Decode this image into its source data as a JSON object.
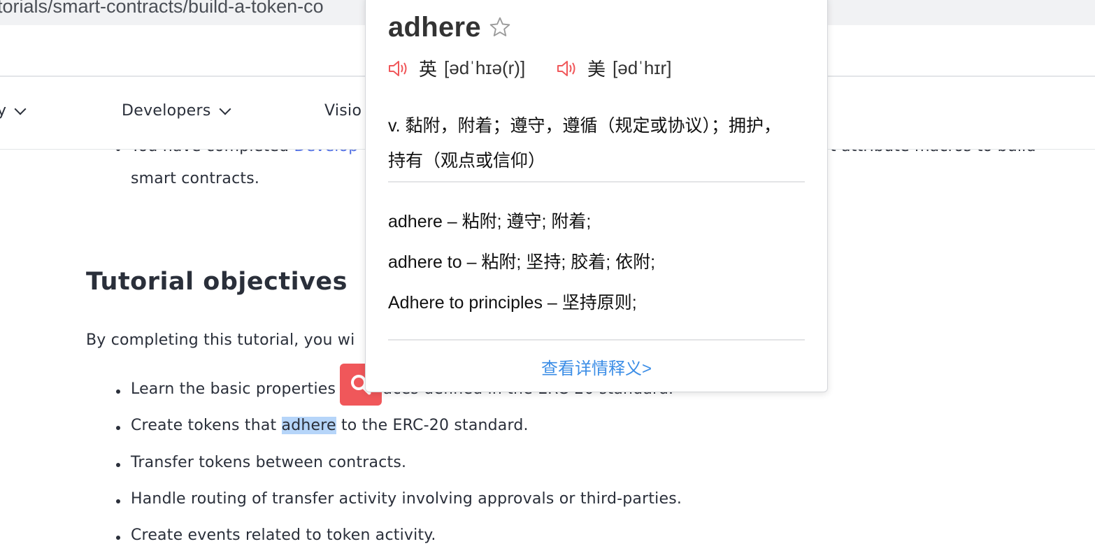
{
  "browser": {
    "url": "torials/smart-contracts/build-a-token-co"
  },
  "nav": {
    "items": [
      {
        "label": "y"
      },
      {
        "label": "Developers"
      },
      {
        "label": "Visio"
      }
    ]
  },
  "content": {
    "bullet_top": {
      "prefix": "You have completed ",
      "link": "Develop",
      "suffix": "t attribute macros to build"
    },
    "bullet_top_line2": "smart contracts.",
    "heading": "Tutorial objectives",
    "intro": "By completing this tutorial, you wi",
    "bullets": [
      {
        "before": "Learn the basic properties",
        "after": " interfaces defined in the ERC-20 standard."
      },
      {
        "before": "Create tokens that ",
        "highlight": "adhere",
        "after": " to the ERC-20 standard."
      },
      {
        "text": "Transfer tokens between contracts."
      },
      {
        "text": "Handle routing of transfer activity involving approvals or third-parties."
      },
      {
        "text": "Create events related to token activity."
      }
    ]
  },
  "popup": {
    "word": "adhere",
    "uk": {
      "label": "英",
      "ipa": "[ədˈhɪə(r)]"
    },
    "us": {
      "label": "美",
      "ipa": "[ədˈhɪr]"
    },
    "definition": "v. 黏附，附着；遵守，遵循（规定或协议）；拥护，持有（观点或信仰）",
    "phrases": [
      "adhere – 粘附; 遵守; 附着;",
      "adhere to – 粘附; 坚持; 胶着; 依附;",
      "Adhere to principles – 坚持原则;"
    ],
    "more_link": "查看详情释义>"
  },
  "colors": {
    "accent": "#3b8de6",
    "speaker": "#f0575a",
    "search_button": "#f0575a",
    "highlight": "#b6d5f9",
    "link": "#4f6ee3"
  },
  "icons": [
    "star-icon",
    "speaker-icon",
    "search-icon",
    "chevron-down-icon"
  ]
}
